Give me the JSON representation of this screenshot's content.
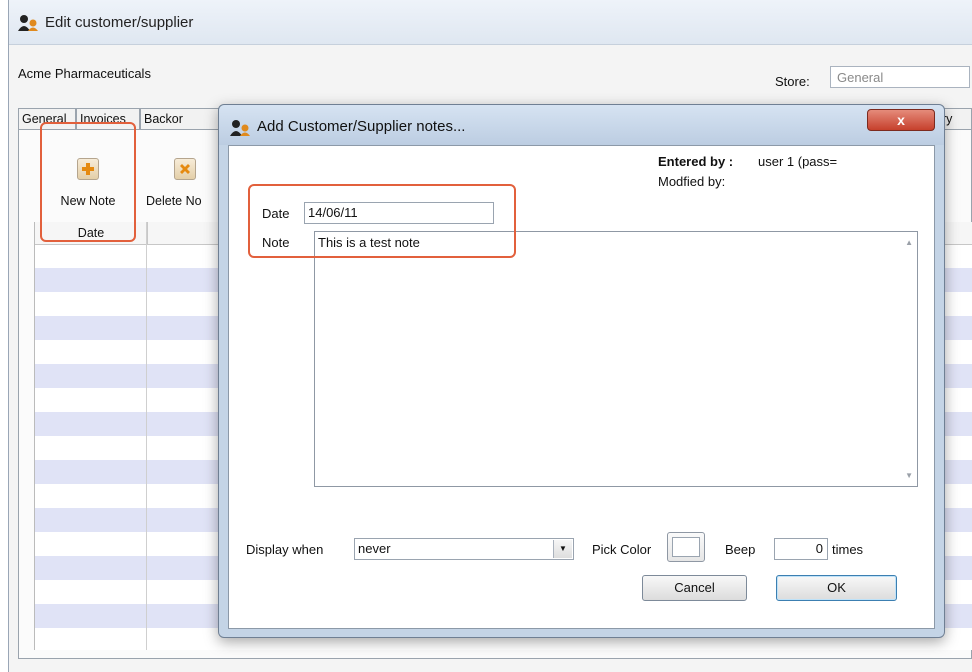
{
  "background_window": {
    "title": "Edit customer/supplier",
    "company_name": "Acme Pharmaceuticals",
    "store_label": "Store:",
    "store_value": "General",
    "tabs": [
      "General",
      "Invoices",
      "Backor"
    ],
    "partial_tab_right": "ory",
    "toolbar": {
      "new_note_label": "New Note",
      "delete_note_label": "Delete No"
    },
    "grid": {
      "column_date": "Date"
    }
  },
  "dialog": {
    "title": "Add Customer/Supplier notes...",
    "close_symbol": "x",
    "date_label": "Date",
    "date_value": "14/06/11",
    "note_label": "Note",
    "note_value": "This is a test note",
    "entered_by_label": "Entered by :",
    "entered_by_value": "user 1 (pass=",
    "modified_by_label": "Modfied by:",
    "display_when_label": "Display when",
    "display_when_value": "never",
    "pick_color_label": "Pick Color",
    "beep_label": "Beep",
    "beep_value": "0",
    "times_label": "times",
    "cancel_label": "Cancel",
    "ok_label": "OK"
  },
  "colors": {
    "highlight": "#e2603c",
    "grid_alt_row": "#e0e3f6",
    "dialog_frame": "#c4d4e6"
  },
  "icons": [
    "app-logo-icon",
    "add-note-icon",
    "delete-note-icon",
    "close-icon",
    "dropdown-arrow-icon"
  ]
}
